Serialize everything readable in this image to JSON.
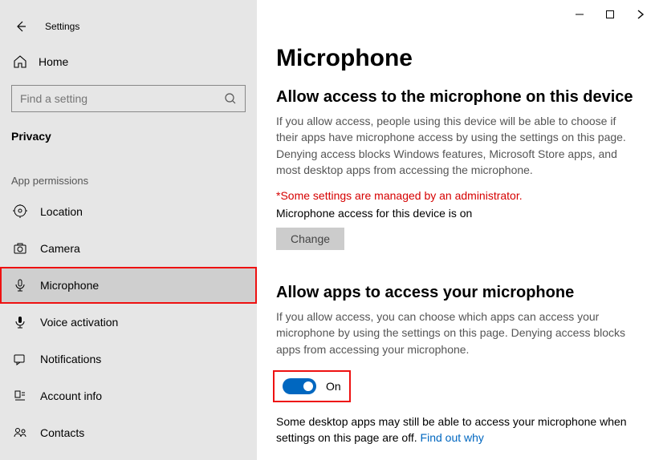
{
  "titlebar": {
    "appname": "Settings"
  },
  "sidebar": {
    "home_label": "Home",
    "search_placeholder": "Find a setting",
    "section_title": "Privacy",
    "subheader": "App permissions",
    "items": [
      {
        "label": "Location"
      },
      {
        "label": "Camera"
      },
      {
        "label": "Microphone"
      },
      {
        "label": "Voice activation"
      },
      {
        "label": "Notifications"
      },
      {
        "label": "Account info"
      },
      {
        "label": "Contacts"
      }
    ]
  },
  "main": {
    "page_title": "Microphone",
    "section1": {
      "heading": "Allow access to the microphone on this device",
      "desc": "If you allow access, people using this device will be able to choose if their apps have microphone access by using the settings on this page. Denying access blocks Windows features, Microsoft Store apps, and most desktop apps from accessing the microphone.",
      "admin_note": "*Some settings are managed by an administrator.",
      "status_text": "Microphone access for this device is on",
      "change_label": "Change"
    },
    "section2": {
      "heading": "Allow apps to access your microphone",
      "desc": "If you allow access, you can choose which apps can access your microphone by using the settings on this page. Denying access blocks apps from accessing your microphone.",
      "toggle_label": "On",
      "footnote_text": "Some desktop apps may still be able to access your microphone when settings on this page are off. ",
      "footnote_link": "Find out why"
    }
  }
}
